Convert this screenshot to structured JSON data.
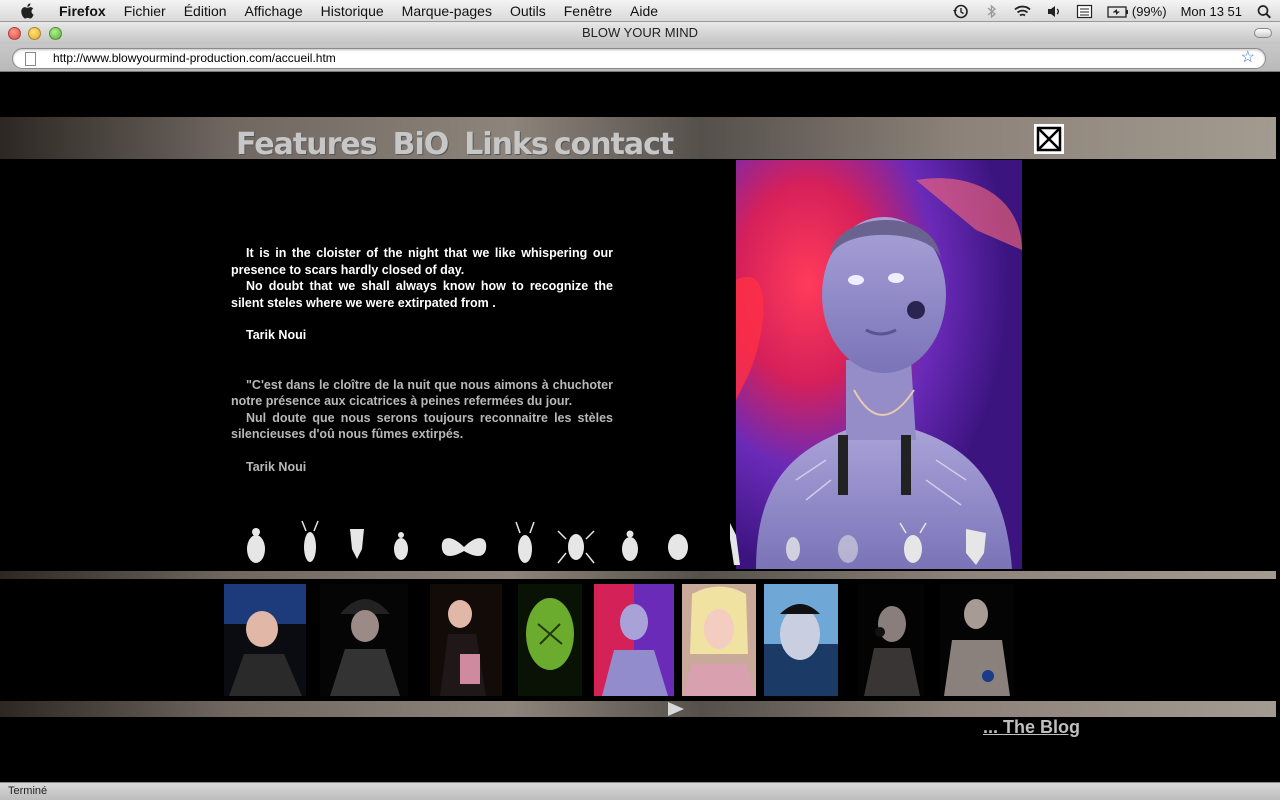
{
  "menubar": {
    "app": "Firefox",
    "items": [
      "Fichier",
      "Édition",
      "Affichage",
      "Historique",
      "Marque-pages",
      "Outils",
      "Fenêtre",
      "Aide"
    ],
    "battery": "(99%)",
    "clock": "Mon 13 51"
  },
  "window": {
    "title": "BLOW YOUR MIND"
  },
  "urlbar": {
    "url": "http://www.blowyourmind-production.com/accueil.htm"
  },
  "nav": {
    "features": "Features",
    "bio": "BiO",
    "links": "Links",
    "contact": "contact"
  },
  "poem": {
    "en_p1": "It is in the cloister of the night that we like whispering our presence to scars hardly closed of day.",
    "en_p2": "No doubt that we shall always know how to recognize the silent steles where we were extirpated from .",
    "en_author": "Tarik Noui",
    "fr_p1": "\"C'est dans le cloître de la nuit que nous aimons à chuchoter notre présence aux cicatrices à peines refermées du jour.",
    "fr_p2": "Nul doute que nous serons toujours reconnaitre les stèles silencieuses d'oû nous fûmes extirpés.",
    "fr_author": "Tarik Noui"
  },
  "insects": [
    "beetle",
    "longhorn-beetle",
    "shield-bug",
    "beetle",
    "moth",
    "longhorn-beetle",
    "ground-beetle",
    "beetle",
    "ladybug",
    "mantis",
    "beetle",
    "grey-blob",
    "longhorn-beetle",
    "shield-bug"
  ],
  "thumbnails": [
    "thumb-1",
    "thumb-2",
    "thumb-3",
    "thumb-4",
    "thumb-5",
    "thumb-6",
    "thumb-7",
    "thumb-8",
    "thumb-9"
  ],
  "blog": {
    "label": "... The Blog"
  },
  "statusbar": {
    "text": "Terminé"
  }
}
